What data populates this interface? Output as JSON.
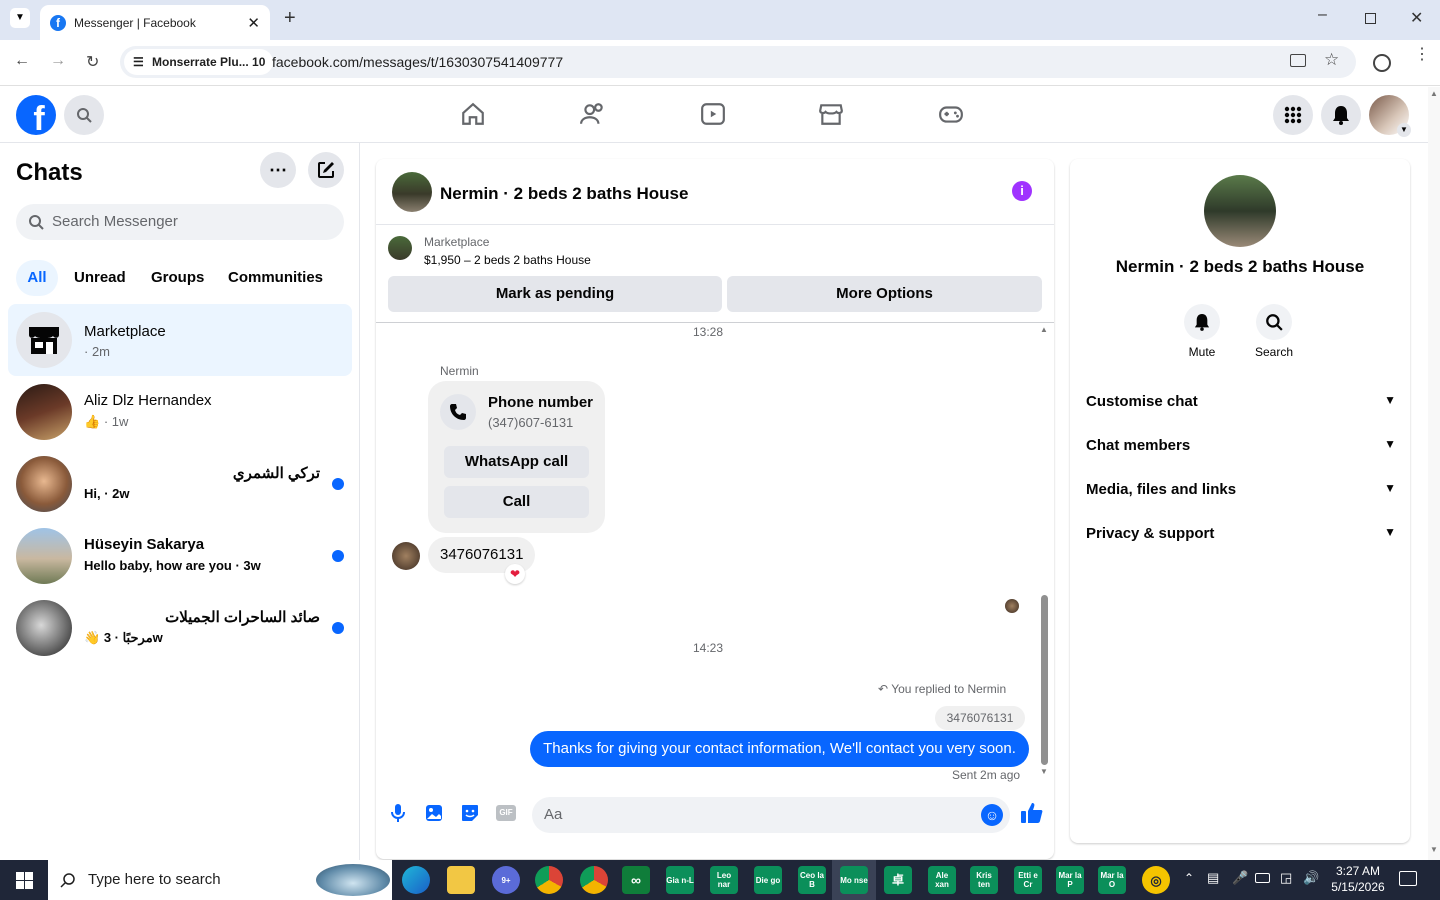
{
  "browser": {
    "tab_title": "Messenger | Facebook",
    "site_chip": "Monserrate Plu... 10",
    "url": "facebook.com/messages/t/1630307541409777"
  },
  "sidebar": {
    "title": "Chats",
    "search_placeholder": "Search Messenger",
    "filters": [
      "All",
      "Unread",
      "Groups",
      "Communities"
    ],
    "chats": [
      {
        "name": "Marketplace",
        "sub": "· 2m"
      },
      {
        "name": "Aliz Dlz Hernandex",
        "sub": "· 1w"
      },
      {
        "name": "تركي الشمري",
        "sub": "Hi, · 2w"
      },
      {
        "name": "Hüseyin Sakarya",
        "sub": "Hello baby, how are you · 3w"
      },
      {
        "name": "صائد الساحرات الجميلات",
        "sub": "مرحبًا · 3w"
      }
    ]
  },
  "conversation": {
    "title": "Nermin · 2 beds 2 baths House",
    "marketplace_label": "Marketplace",
    "listing": "$1,950 – 2 beds 2 baths House",
    "mark_pending": "Mark as pending",
    "more_options": "More Options",
    "time1": "13:28",
    "sender": "Nermin",
    "phone_title": "Phone number",
    "phone_value": "(347)607-6131",
    "whatsapp_call": "WhatsApp call",
    "call": "Call",
    "number_message": "3476076131",
    "time2": "14:23",
    "replied_label": "You replied to Nermin",
    "replied_quote": "3476076131",
    "sent_message": "Thanks for giving your contact information, We'll contact you very soon.",
    "sent_status": "Sent 2m ago",
    "composer_placeholder": "Aa"
  },
  "info_panel": {
    "title": "Nermin · 2 beds 2 baths House",
    "mute": "Mute",
    "search": "Search",
    "sections": [
      "Customise chat",
      "Chat members",
      "Media, files and links",
      "Privacy & support"
    ]
  },
  "taskbar": {
    "search_placeholder": "Type here to search",
    "apps": [
      "Gia n-L",
      "Leo nar",
      "Die go",
      "Ceo la B",
      "Mo nse",
      "Ale xan",
      "Kris ten",
      "Etti e Cr",
      "Mar la P",
      "Mar la O"
    ],
    "time": "3:27 AM",
    "date": "5/15/2026"
  },
  "colors": {
    "accent": "#0866ff",
    "info_icon": "#a033ff"
  }
}
